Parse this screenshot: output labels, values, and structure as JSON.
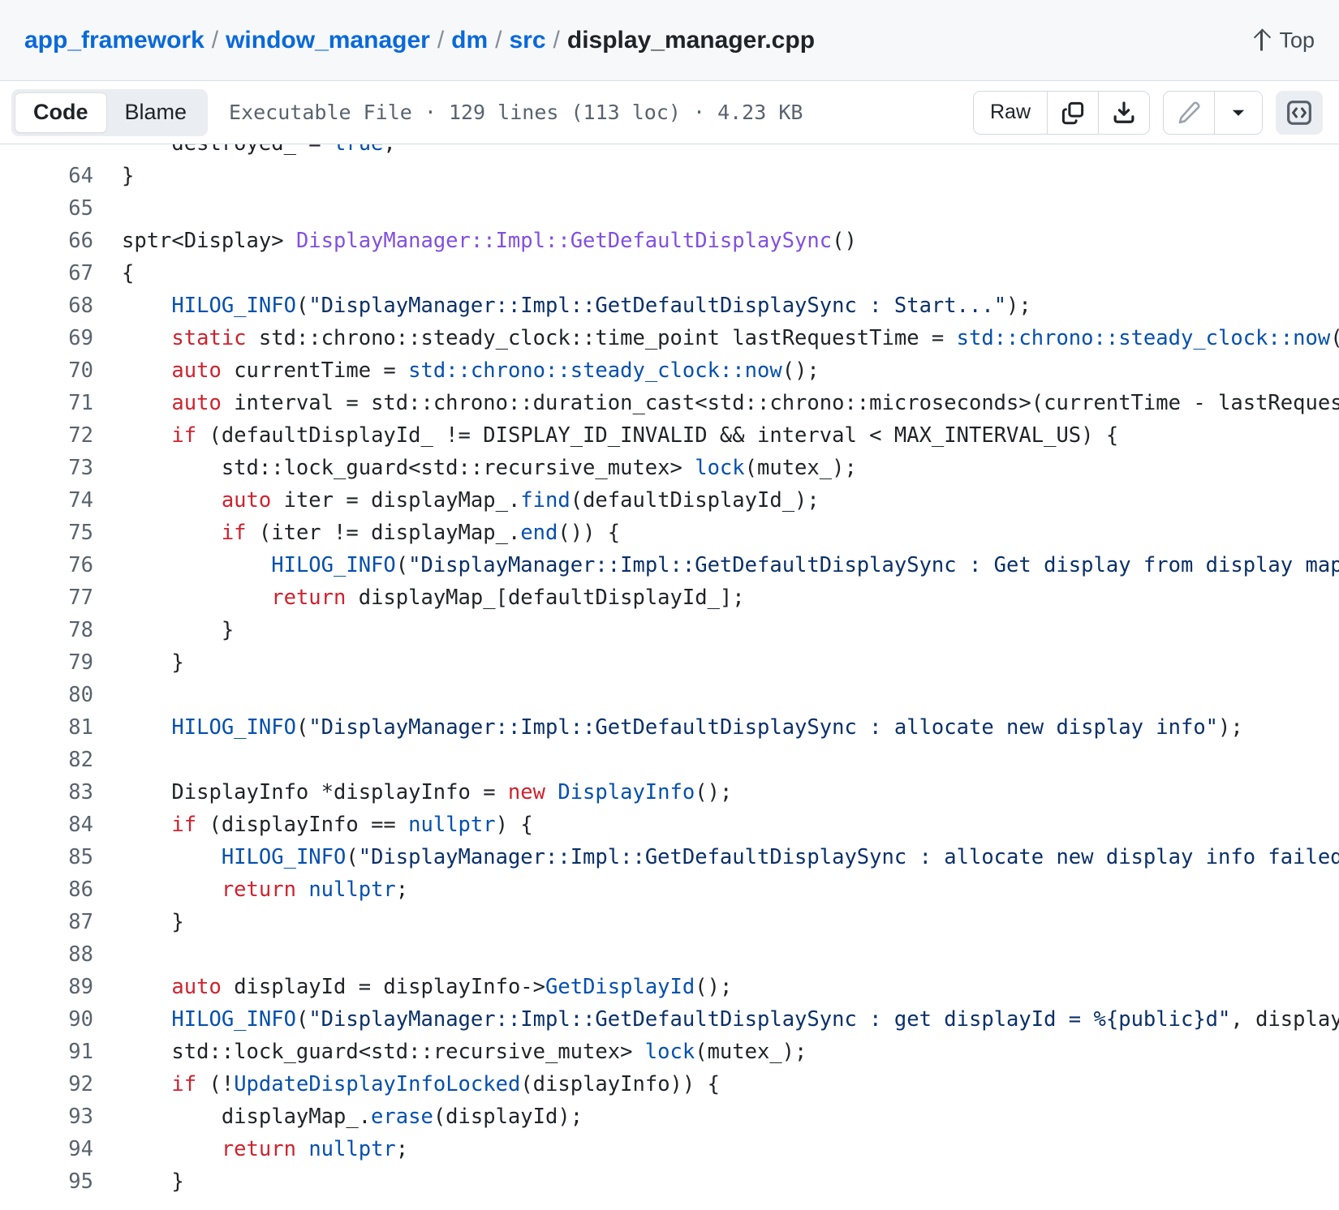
{
  "breadcrumb": {
    "parts": [
      "app_framework",
      "window_manager",
      "dm",
      "src"
    ],
    "separator": "/",
    "current": "display_manager.cpp"
  },
  "header": {
    "top_label": "Top",
    "top_icon": "arrow-up-icon"
  },
  "toolbar": {
    "code_tab": "Code",
    "blame_tab": "Blame",
    "active_tab": "Code",
    "file_meta": "Executable File · 129 lines (113 loc) · 4.23 KB",
    "raw_label": "Raw",
    "copy_icon": "copy-icon",
    "download_icon": "download-icon",
    "edit_icon": "pencil-icon",
    "dropdown_icon": "chevron-down-icon",
    "code_view_icon": "code-brackets-icon"
  },
  "colors": {
    "link": "#0969da",
    "keyword": "#cf222e",
    "function": "#0550ae",
    "string": "#0a3069",
    "type": "#8250df",
    "text": "#1f2328",
    "muted": "#59636e",
    "header_bg": "#f6f8fa",
    "border": "#d8dee4"
  },
  "code": {
    "first_visible_line": 63,
    "lines": [
      {
        "n": 63,
        "partial": true,
        "tokens": [
          {
            "t": "    destroyed_ = ",
            "c": "pl"
          },
          {
            "t": "true",
            "c": "cn"
          },
          {
            "t": ";",
            "c": "pl"
          }
        ]
      },
      {
        "n": 64,
        "tokens": [
          {
            "t": "}",
            "c": "pl"
          }
        ]
      },
      {
        "n": 65,
        "tokens": [
          {
            "t": "",
            "c": "pl"
          }
        ]
      },
      {
        "n": 66,
        "tokens": [
          {
            "t": "sptr<Display> ",
            "c": "pl"
          },
          {
            "t": "DisplayManager::Impl::GetDefaultDisplaySync",
            "c": "ty"
          },
          {
            "t": "()",
            "c": "pl"
          }
        ]
      },
      {
        "n": 67,
        "tokens": [
          {
            "t": "{",
            "c": "pl"
          }
        ]
      },
      {
        "n": 68,
        "tokens": [
          {
            "t": "    ",
            "c": "pl"
          },
          {
            "t": "HILOG_INFO",
            "c": "fn"
          },
          {
            "t": "(",
            "c": "pl"
          },
          {
            "t": "\"DisplayManager::Impl::GetDefaultDisplaySync : Start...\"",
            "c": "str"
          },
          {
            "t": ");",
            "c": "pl"
          }
        ]
      },
      {
        "n": 69,
        "tokens": [
          {
            "t": "    ",
            "c": "pl"
          },
          {
            "t": "static",
            "c": "kw"
          },
          {
            "t": " std::chrono::steady_clock::time_point lastRequestTime = ",
            "c": "pl"
          },
          {
            "t": "std::chrono::steady_clock::now",
            "c": "fn"
          },
          {
            "t": "();",
            "c": "pl"
          }
        ]
      },
      {
        "n": 70,
        "tokens": [
          {
            "t": "    ",
            "c": "pl"
          },
          {
            "t": "auto",
            "c": "kw"
          },
          {
            "t": " currentTime = ",
            "c": "pl"
          },
          {
            "t": "std::chrono::steady_clock::now",
            "c": "fn"
          },
          {
            "t": "();",
            "c": "pl"
          }
        ]
      },
      {
        "n": 71,
        "tokens": [
          {
            "t": "    ",
            "c": "pl"
          },
          {
            "t": "auto",
            "c": "kw"
          },
          {
            "t": " interval = std::chrono::duration_cast<std::chrono::microseconds>(currentTime - lastRequestTime).count();",
            "c": "pl"
          }
        ]
      },
      {
        "n": 72,
        "tokens": [
          {
            "t": "    ",
            "c": "pl"
          },
          {
            "t": "if",
            "c": "kw"
          },
          {
            "t": " (defaultDisplayId_ != DISPLAY_ID_INVALID && interval < MAX_INTERVAL_US) {",
            "c": "pl"
          }
        ]
      },
      {
        "n": 73,
        "tokens": [
          {
            "t": "        std::lock_guard<std::recursive_mutex> ",
            "c": "pl"
          },
          {
            "t": "lock",
            "c": "fn"
          },
          {
            "t": "(mutex_);",
            "c": "pl"
          }
        ]
      },
      {
        "n": 74,
        "tokens": [
          {
            "t": "        ",
            "c": "pl"
          },
          {
            "t": "auto",
            "c": "kw"
          },
          {
            "t": " iter = displayMap_.",
            "c": "pl"
          },
          {
            "t": "find",
            "c": "fn"
          },
          {
            "t": "(defaultDisplayId_);",
            "c": "pl"
          }
        ]
      },
      {
        "n": 75,
        "tokens": [
          {
            "t": "        ",
            "c": "pl"
          },
          {
            "t": "if",
            "c": "kw"
          },
          {
            "t": " (iter != displayMap_.",
            "c": "pl"
          },
          {
            "t": "end",
            "c": "fn"
          },
          {
            "t": "()) {",
            "c": "pl"
          }
        ]
      },
      {
        "n": 76,
        "tokens": [
          {
            "t": "            ",
            "c": "pl"
          },
          {
            "t": "HILOG_INFO",
            "c": "fn"
          },
          {
            "t": "(",
            "c": "pl"
          },
          {
            "t": "\"DisplayManager::Impl::GetDefaultDisplaySync : Get display from display map\"",
            "c": "str"
          },
          {
            "t": ");",
            "c": "pl"
          }
        ]
      },
      {
        "n": 77,
        "tokens": [
          {
            "t": "            ",
            "c": "pl"
          },
          {
            "t": "return",
            "c": "kw"
          },
          {
            "t": " displayMap_[defaultDisplayId_];",
            "c": "pl"
          }
        ]
      },
      {
        "n": 78,
        "tokens": [
          {
            "t": "        }",
            "c": "pl"
          }
        ]
      },
      {
        "n": 79,
        "tokens": [
          {
            "t": "    }",
            "c": "pl"
          }
        ]
      },
      {
        "n": 80,
        "tokens": [
          {
            "t": "",
            "c": "pl"
          }
        ]
      },
      {
        "n": 81,
        "tokens": [
          {
            "t": "    ",
            "c": "pl"
          },
          {
            "t": "HILOG_INFO",
            "c": "fn"
          },
          {
            "t": "(",
            "c": "pl"
          },
          {
            "t": "\"DisplayManager::Impl::GetDefaultDisplaySync : allocate new display info\"",
            "c": "str"
          },
          {
            "t": ");",
            "c": "pl"
          }
        ]
      },
      {
        "n": 82,
        "tokens": [
          {
            "t": "",
            "c": "pl"
          }
        ]
      },
      {
        "n": 83,
        "tokens": [
          {
            "t": "    DisplayInfo *displayInfo = ",
            "c": "pl"
          },
          {
            "t": "new",
            "c": "kw"
          },
          {
            "t": " ",
            "c": "pl"
          },
          {
            "t": "DisplayInfo",
            "c": "fn"
          },
          {
            "t": "();",
            "c": "pl"
          }
        ]
      },
      {
        "n": 84,
        "tokens": [
          {
            "t": "    ",
            "c": "pl"
          },
          {
            "t": "if",
            "c": "kw"
          },
          {
            "t": " (displayInfo == ",
            "c": "pl"
          },
          {
            "t": "nullptr",
            "c": "cn"
          },
          {
            "t": ") {",
            "c": "pl"
          }
        ]
      },
      {
        "n": 85,
        "tokens": [
          {
            "t": "        ",
            "c": "pl"
          },
          {
            "t": "HILOG_INFO",
            "c": "fn"
          },
          {
            "t": "(",
            "c": "pl"
          },
          {
            "t": "\"DisplayManager::Impl::GetDefaultDisplaySync : allocate new display info failed!\"",
            "c": "str"
          },
          {
            "t": ");",
            "c": "pl"
          }
        ]
      },
      {
        "n": 86,
        "tokens": [
          {
            "t": "        ",
            "c": "pl"
          },
          {
            "t": "return",
            "c": "kw"
          },
          {
            "t": " ",
            "c": "pl"
          },
          {
            "t": "nullptr",
            "c": "cn"
          },
          {
            "t": ";",
            "c": "pl"
          }
        ]
      },
      {
        "n": 87,
        "tokens": [
          {
            "t": "    }",
            "c": "pl"
          }
        ]
      },
      {
        "n": 88,
        "tokens": [
          {
            "t": "",
            "c": "pl"
          }
        ]
      },
      {
        "n": 89,
        "tokens": [
          {
            "t": "    ",
            "c": "pl"
          },
          {
            "t": "auto",
            "c": "kw"
          },
          {
            "t": " displayId = displayInfo->",
            "c": "pl"
          },
          {
            "t": "GetDisplayId",
            "c": "fn"
          },
          {
            "t": "();",
            "c": "pl"
          }
        ]
      },
      {
        "n": 90,
        "tokens": [
          {
            "t": "    ",
            "c": "pl"
          },
          {
            "t": "HILOG_INFO",
            "c": "fn"
          },
          {
            "t": "(",
            "c": "pl"
          },
          {
            "t": "\"DisplayManager::Impl::GetDefaultDisplaySync : get displayId = %{public}d\"",
            "c": "str"
          },
          {
            "t": ", displayId);",
            "c": "pl"
          }
        ]
      },
      {
        "n": 91,
        "tokens": [
          {
            "t": "    std::lock_guard<std::recursive_mutex> ",
            "c": "pl"
          },
          {
            "t": "lock",
            "c": "fn"
          },
          {
            "t": "(mutex_);",
            "c": "pl"
          }
        ]
      },
      {
        "n": 92,
        "tokens": [
          {
            "t": "    ",
            "c": "pl"
          },
          {
            "t": "if",
            "c": "kw"
          },
          {
            "t": " (!",
            "c": "pl"
          },
          {
            "t": "UpdateDisplayInfoLocked",
            "c": "fn"
          },
          {
            "t": "(displayInfo)) {",
            "c": "pl"
          }
        ]
      },
      {
        "n": 93,
        "tokens": [
          {
            "t": "        displayMap_.",
            "c": "pl"
          },
          {
            "t": "erase",
            "c": "fn"
          },
          {
            "t": "(displayId);",
            "c": "pl"
          }
        ]
      },
      {
        "n": 94,
        "tokens": [
          {
            "t": "        ",
            "c": "pl"
          },
          {
            "t": "return",
            "c": "kw"
          },
          {
            "t": " ",
            "c": "pl"
          },
          {
            "t": "nullptr",
            "c": "cn"
          },
          {
            "t": ";",
            "c": "pl"
          }
        ]
      },
      {
        "n": 95,
        "tokens": [
          {
            "t": "    }",
            "c": "pl"
          }
        ]
      }
    ]
  }
}
